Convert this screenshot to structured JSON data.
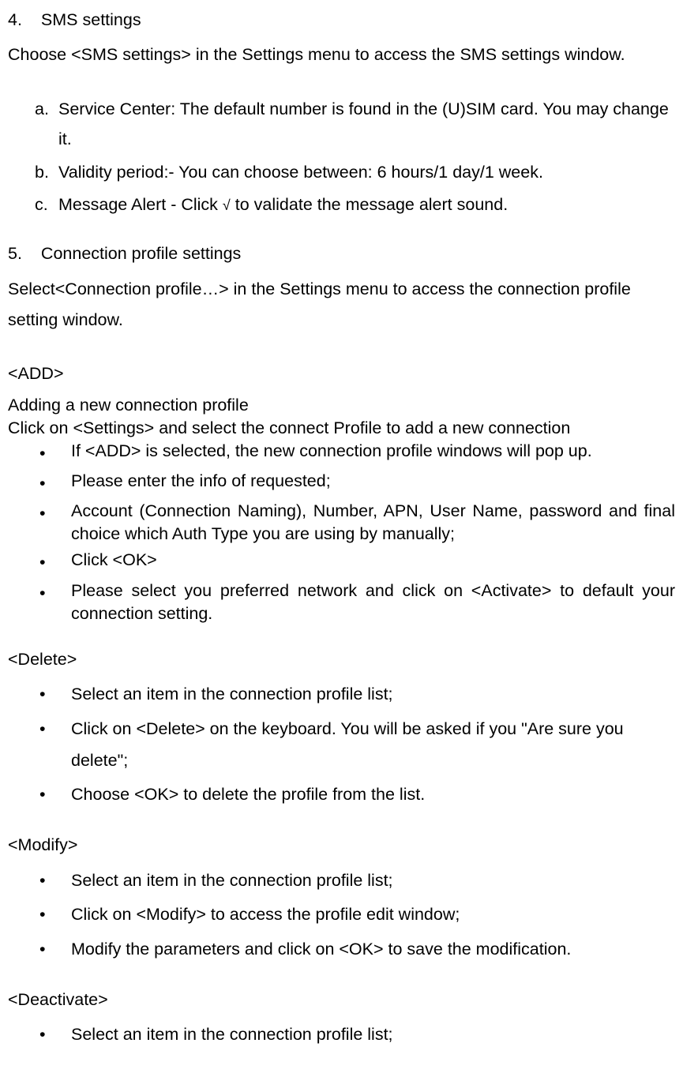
{
  "sec4": {
    "num": "4.",
    "title": "SMS settings",
    "intro": "Choose <SMS settings> in the Settings menu to access the SMS settings window.",
    "items": [
      {
        "marker": "a.",
        "text": "Service Center: The default number is found in the (U)SIM card. You may change it."
      },
      {
        "marker": "b.",
        "text": "Validity period:- You can choose between: 6 hours/1 day/1 week."
      },
      {
        "marker": "c.",
        "text_before": "Message Alert - Click  ",
        "check": "√",
        "text_after": "  to validate the message alert sound."
      }
    ]
  },
  "sec5": {
    "num": "5.",
    "title": "Connection profile settings",
    "intro": "Select<Connection profile…> in the Settings menu to access the connection profile setting window."
  },
  "add": {
    "heading": "<ADD>",
    "sub1": "Adding a new connection profile",
    "sub2": "Click on <Settings> and select the connect Profile to add a new connection",
    "items": [
      "If <ADD> is selected, the new connection profile windows will pop up.",
      "Please enter the info of requested;",
      "Account (Connection Naming), Number, APN, User Name, password and final choice which Auth Type you are using by manually;",
      "Click <OK>",
      "Please select you preferred network and click on <Activate> to default your connection setting."
    ]
  },
  "del": {
    "heading": "<Delete>",
    "items": [
      "Select an item in the connection profile list;",
      "Click on <Delete> on the keyboard. You will be asked if you \"Are sure you delete\";",
      "Choose <OK> to delete the profile from the list."
    ]
  },
  "mod": {
    "heading": "<Modify>",
    "items": [
      "Select an item in the connection profile list;",
      "Click on <Modify> to access the profile edit window;",
      "Modify the parameters and click on <OK> to save the modification."
    ]
  },
  "deact": {
    "heading": "<Deactivate>",
    "items": [
      "Select an item in the connection profile list;"
    ]
  },
  "bullet": "•"
}
